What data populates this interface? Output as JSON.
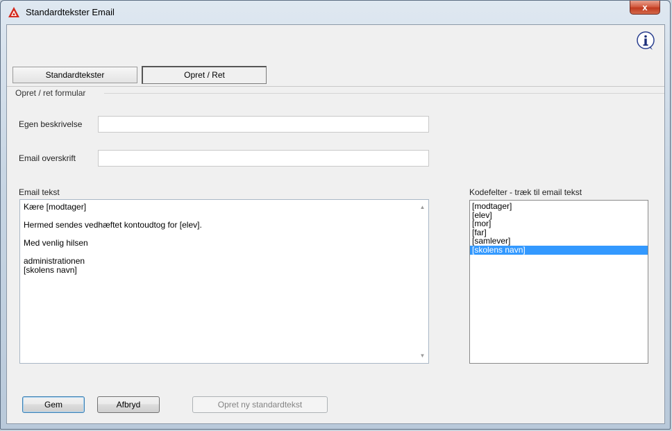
{
  "window": {
    "title": "Standardtekster Email",
    "close_label": "x"
  },
  "tabs": [
    {
      "label": "Standardtekster",
      "active": false
    },
    {
      "label": "Opret / Ret",
      "active": true
    }
  ],
  "form": {
    "group_title": "Opret / ret formular",
    "description_label": "Egen beskrivelse",
    "description_value": "",
    "subject_label": "Email overskrift",
    "subject_value": "",
    "body_label": "Email tekst",
    "body_value": "Kære [modtager]\n\nHermed sendes vedhæftet kontoudtog for [elev].\n\nMed venlig hilsen\n\nadministrationen\n[skolens navn]"
  },
  "codefields": {
    "label": "Kodefelter - træk til email tekst",
    "items": [
      "[modtager]",
      "[elev]",
      "[mor]",
      "[far]",
      "[samlever]",
      "[skolens navn]"
    ],
    "selected_index": 5
  },
  "buttons": {
    "save": "Gem",
    "cancel": "Afbryd",
    "create_new": "Opret ny standardtekst"
  },
  "colors": {
    "selection": "#3399ff",
    "close_button": "#c03a1f"
  }
}
